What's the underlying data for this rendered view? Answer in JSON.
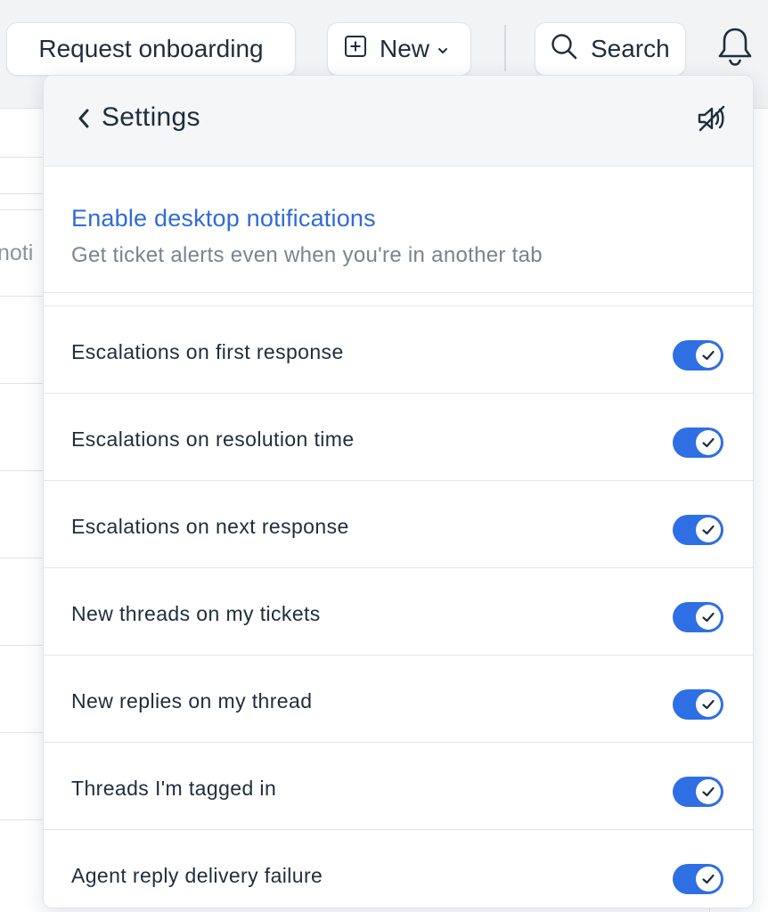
{
  "topbar": {
    "onboarding_label": "Request onboarding",
    "new_label": "New",
    "search_label": "Search"
  },
  "background": {
    "partial_text": "noti"
  },
  "settings": {
    "title": "Settings",
    "desktop": {
      "link": "Enable desktop notifications",
      "subtitle": "Get ticket alerts even when you're in another tab"
    },
    "items": [
      {
        "label": "Escalations on first response",
        "enabled": true
      },
      {
        "label": "Escalations on resolution time",
        "enabled": true
      },
      {
        "label": "Escalations on next response",
        "enabled": true
      },
      {
        "label": "New threads on my tickets",
        "enabled": true
      },
      {
        "label": "New replies on my thread",
        "enabled": true
      },
      {
        "label": "Threads I'm tagged in",
        "enabled": true
      },
      {
        "label": "Agent reply delivery failure",
        "enabled": true
      }
    ]
  },
  "icons": {
    "new": "plus-square-icon",
    "new_caret": "chevron-down-icon",
    "search": "search-icon",
    "bell": "bell-icon",
    "back": "chevron-left-icon",
    "mute": "speaker-muted-icon",
    "toggle_check": "check-icon"
  },
  "colors": {
    "accent": "#2f6fe4",
    "link": "#2f6bd8",
    "text": "#1f2d3d",
    "muted_text": "#7b838d",
    "panel_header_bg": "#f4f6f8"
  }
}
